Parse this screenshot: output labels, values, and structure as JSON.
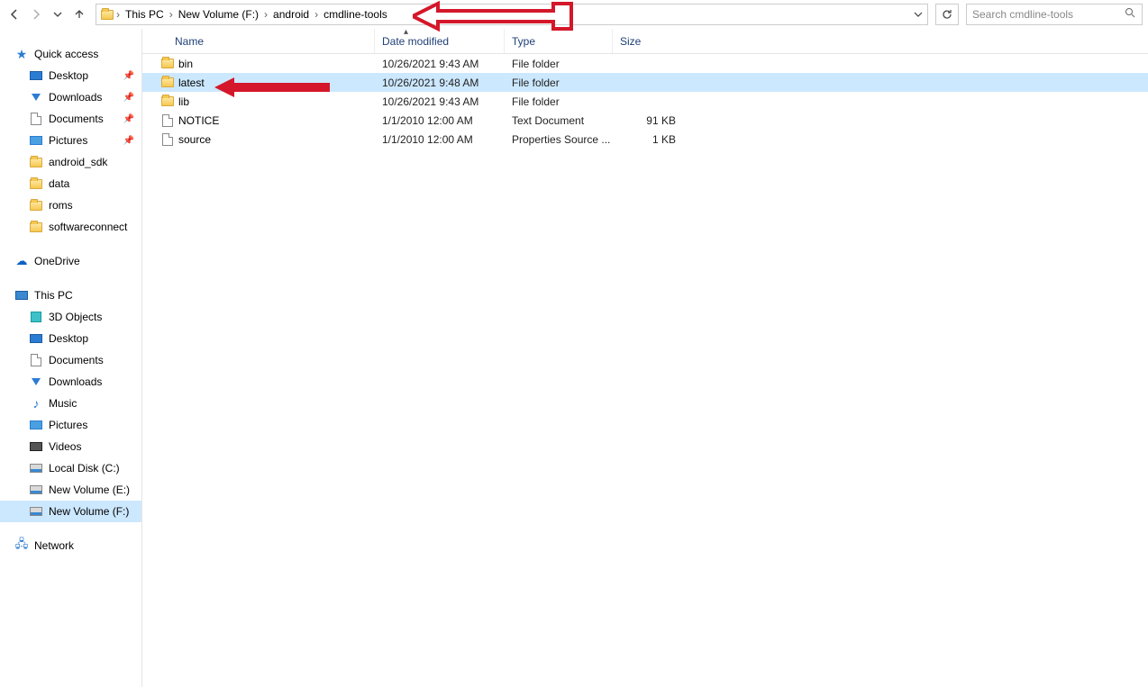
{
  "breadcrumbs": [
    "This PC",
    "New Volume (F:)",
    "android",
    "cmdline-tools"
  ],
  "search_placeholder": "Search cmdline-tools",
  "columns": {
    "name": "Name",
    "date": "Date modified",
    "type": "Type",
    "size": "Size"
  },
  "rows": [
    {
      "name": "bin",
      "date": "10/26/2021 9:43 AM",
      "type": "File folder",
      "size": "",
      "icon": "folder",
      "selected": false
    },
    {
      "name": "latest",
      "date": "10/26/2021 9:48 AM",
      "type": "File folder",
      "size": "",
      "icon": "folder",
      "selected": true
    },
    {
      "name": "lib",
      "date": "10/26/2021 9:43 AM",
      "type": "File folder",
      "size": "",
      "icon": "folder",
      "selected": false
    },
    {
      "name": "NOTICE",
      "date": "1/1/2010 12:00 AM",
      "type": "Text Document",
      "size": "91 KB",
      "icon": "file",
      "selected": false
    },
    {
      "name": "source",
      "date": "1/1/2010 12:00 AM",
      "type": "Properties Source ...",
      "size": "1 KB",
      "icon": "file",
      "selected": false
    }
  ],
  "nav": {
    "quick_access": {
      "label": "Quick access",
      "items": [
        {
          "label": "Desktop",
          "icon": "desktop",
          "pinned": true
        },
        {
          "label": "Downloads",
          "icon": "download",
          "pinned": true
        },
        {
          "label": "Documents",
          "icon": "doc",
          "pinned": true
        },
        {
          "label": "Pictures",
          "icon": "pic",
          "pinned": true
        },
        {
          "label": "android_sdk",
          "icon": "folder",
          "pinned": false
        },
        {
          "label": "data",
          "icon": "folder",
          "pinned": false
        },
        {
          "label": "roms",
          "icon": "folder",
          "pinned": false
        },
        {
          "label": "softwareconnect",
          "icon": "folder",
          "pinned": false
        }
      ]
    },
    "onedrive": {
      "label": "OneDrive"
    },
    "this_pc": {
      "label": "This PC",
      "items": [
        {
          "label": "3D Objects",
          "icon": "3d"
        },
        {
          "label": "Desktop",
          "icon": "desktop"
        },
        {
          "label": "Documents",
          "icon": "doc"
        },
        {
          "label": "Downloads",
          "icon": "download"
        },
        {
          "label": "Music",
          "icon": "music"
        },
        {
          "label": "Pictures",
          "icon": "pic"
        },
        {
          "label": "Videos",
          "icon": "video"
        },
        {
          "label": "Local Disk (C:)",
          "icon": "disk"
        },
        {
          "label": "New Volume (E:)",
          "icon": "disk"
        },
        {
          "label": "New Volume (F:)",
          "icon": "disk",
          "selected": true
        }
      ]
    },
    "network": {
      "label": "Network"
    }
  }
}
